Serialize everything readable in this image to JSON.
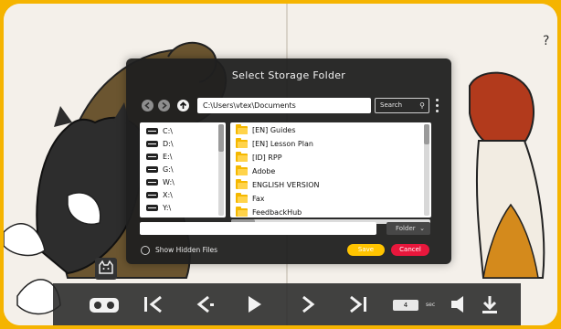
{
  "dialog": {
    "title": "Select Storage Folder",
    "path_value": "C:\\Users\\vtex\\Documents",
    "search_label": "Search",
    "drives": [
      "C:\\",
      "D:\\",
      "E:\\",
      "G:\\",
      "W:\\",
      "X:\\",
      "Y:\\"
    ],
    "folders": [
      "[EN] Guides",
      "[EN] Lesson Plan",
      "[ID] RPP",
      "Adobe",
      "ENGLISH VERSION",
      "Fax",
      "FeedbackHub"
    ],
    "file_type_label": "Folder",
    "show_hidden_label": "Show Hidden Files",
    "save_label": "Save",
    "cancel_label": "Cancel"
  },
  "player": {
    "timer_value": "4",
    "timer_unit": "sec"
  },
  "colors": {
    "frame": "#f5b400",
    "save": "#ffc400",
    "cancel": "#e8173c",
    "folder_icon": "#f5b800"
  },
  "icons": [
    "back-arrow-icon",
    "forward-arrow-icon",
    "up-arrow-icon",
    "search-icon",
    "more-vert-icon",
    "drive-icon",
    "folder-icon",
    "vr-headset-icon",
    "first-page-icon",
    "previous-page-icon",
    "play-icon",
    "next-page-icon",
    "last-page-icon",
    "volume-icon",
    "download-icon",
    "cat-face-icon"
  ]
}
